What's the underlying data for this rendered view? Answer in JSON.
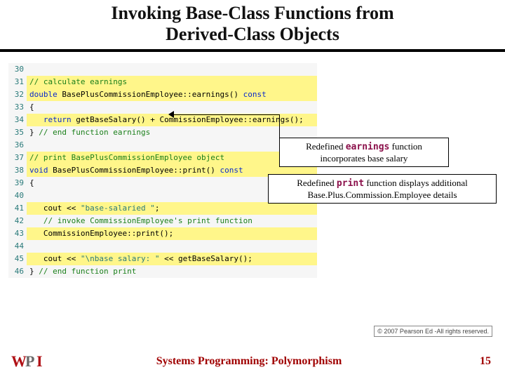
{
  "title_line1": "Invoking Base-Class Functions from",
  "title_line2": "Derived-Class Objects",
  "code": [
    {
      "n": "30",
      "hl": false,
      "html": ""
    },
    {
      "n": "31",
      "hl": true,
      "html": "<span class='c-comment'>// calculate earnings</span>"
    },
    {
      "n": "32",
      "hl": true,
      "html": "<span class='c-kw'>double</span> BasePlusCommissionEmployee::earnings() <span class='c-kw'>const</span>"
    },
    {
      "n": "33",
      "hl": false,
      "html": "{"
    },
    {
      "n": "34",
      "hl": true,
      "html": "   <span class='c-kw'>return</span> getBaseSalary() + CommissionEmployee::earnings();"
    },
    {
      "n": "35",
      "hl": false,
      "html": "} <span class='c-comment'>// end function earnings</span>"
    },
    {
      "n": "36",
      "hl": false,
      "html": ""
    },
    {
      "n": "37",
      "hl": true,
      "html": "<span class='c-comment'>// print BasePlusCommissionEmployee object</span>"
    },
    {
      "n": "38",
      "hl": true,
      "html": "<span class='c-kw'>void</span> BasePlusCommissionEmployee::print() <span class='c-kw'>const</span>"
    },
    {
      "n": "39",
      "hl": false,
      "html": "{"
    },
    {
      "n": "40",
      "hl": false,
      "html": ""
    },
    {
      "n": "41",
      "hl": true,
      "html": "   cout &lt;&lt; <span class='c-str'>\"base-salaried \"</span>;"
    },
    {
      "n": "42",
      "hl": false,
      "html": "   <span class='c-comment'>// invoke CommissionEmployee's print function</span>"
    },
    {
      "n": "43",
      "hl": true,
      "html": "   CommissionEmployee::print();"
    },
    {
      "n": "44",
      "hl": false,
      "html": ""
    },
    {
      "n": "45",
      "hl": true,
      "html": "   cout &lt;&lt; <span class='c-str'>\"\\nbase salary: \"</span> &lt;&lt; getBaseSalary();"
    },
    {
      "n": "46",
      "hl": false,
      "html": "} <span class='c-comment'>// end function print</span>"
    }
  ],
  "callout_earnings_pre": "Redefined ",
  "callout_earnings_mono": "earnings",
  "callout_earnings_post": " function incorporates base salary",
  "callout_print_pre": "Redefined ",
  "callout_print_mono": "print",
  "callout_print_post": " function displays additional Base.Plus.Commission.Employee details",
  "copyright": "© 2007 Pearson Ed -All rights reserved.",
  "footer_title": "Systems Programming:  Polymorphism",
  "page_number": "15",
  "logo_text": "WPI"
}
